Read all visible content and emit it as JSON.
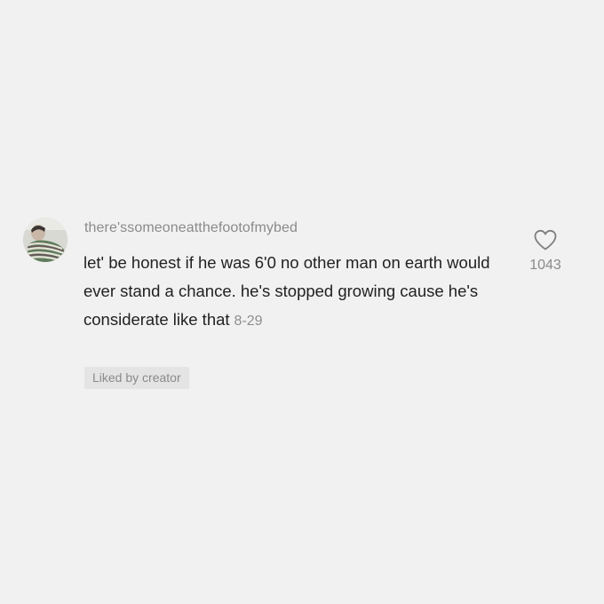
{
  "comment": {
    "username": "there'ssomeoneatthefootofmybed",
    "text": "let' be honest if he was 6'0 no other man on earth would ever stand a chance. he's stopped growing cause he's considerate like that",
    "timestamp": "8-29",
    "badge": "Liked by creator",
    "like_count": "1043",
    "like_icon": "heart-outline-icon",
    "avatar": "user-avatar"
  },
  "colors": {
    "background": "#f1f1f1",
    "text": "#222222",
    "muted": "#8a8a8a",
    "badge_bg": "#e4e4e4"
  }
}
